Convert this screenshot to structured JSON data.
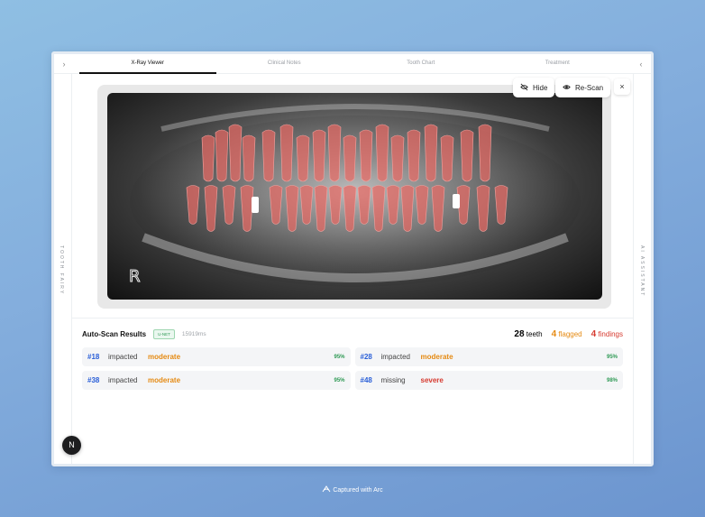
{
  "tabs": [
    {
      "label": "X-Ray Viewer",
      "active": true
    },
    {
      "label": "Clinical Notes",
      "active": false
    },
    {
      "label": "Tooth Chart",
      "active": false
    },
    {
      "label": "Treatment",
      "active": false
    }
  ],
  "rails": {
    "left_label": "TOOTH FAIRY",
    "right_label": "AI ASSISTANT"
  },
  "xray": {
    "marker": "R",
    "hide_label": "Hide",
    "rescan_label": "Re-Scan",
    "close_glyph": "×"
  },
  "results": {
    "title": "Auto-Scan Results",
    "model_badge": "U-NET",
    "timing": "15919ms",
    "stats": {
      "teeth_count": "28",
      "teeth_label": "teeth",
      "flagged_count": "4",
      "flagged_label": "flagged",
      "findings_count": "4",
      "findings_label": "findings"
    },
    "items": [
      {
        "tooth": "#18",
        "condition": "impacted",
        "severity": "moderate",
        "confidence": "95%"
      },
      {
        "tooth": "#28",
        "condition": "impacted",
        "severity": "moderate",
        "confidence": "95%"
      },
      {
        "tooth": "#38",
        "condition": "impacted",
        "severity": "moderate",
        "confidence": "95%"
      },
      {
        "tooth": "#48",
        "condition": "missing",
        "severity": "severe",
        "confidence": "98%"
      }
    ]
  },
  "fab_letter": "N",
  "footer": "Captured with Arc",
  "colors": {
    "moderate": "#e58a12",
    "severe": "#d63a2f",
    "flagged": "#e58a12",
    "findings": "#d63a2f",
    "tooth_overlay": "#e86a64"
  }
}
